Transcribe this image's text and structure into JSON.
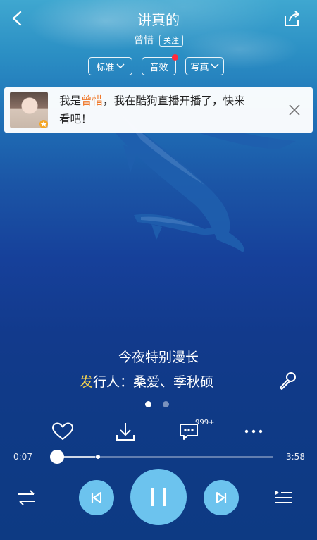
{
  "header": {
    "title": "讲真的",
    "artist": "曾惜",
    "follow_label": "关注"
  },
  "options": {
    "quality_label": "标准",
    "effects_label": "音效",
    "photo_label": "写真"
  },
  "notice": {
    "prefix": "我是",
    "name": "曾惜",
    "line1_suffix": "，我在酷狗直播开播了，快来",
    "line2": "看吧！"
  },
  "lyrics": {
    "current": "今夜特别漫长",
    "next_first_char": "发",
    "next_rest": "行人：桑爱、季秋硕"
  },
  "actions": {
    "comment_count": "999+"
  },
  "player": {
    "elapsed": "0:07",
    "duration": "3:58",
    "progress_fraction": 0.03,
    "buffered_fraction": 0.2,
    "page_index": 1,
    "page_count": 2
  },
  "colors": {
    "accent_circle": "#6cc3ee",
    "highlight_name": "#f07a2c",
    "lyric_highlight": "#f4d34f",
    "notification_dot": "#ff2a3a"
  }
}
